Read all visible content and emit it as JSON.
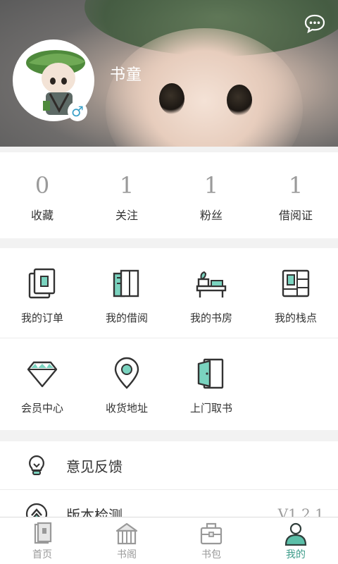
{
  "profile": {
    "username": "书童",
    "gender_symbol": "♂"
  },
  "stats": [
    {
      "count": "0",
      "label": "收藏"
    },
    {
      "count": "1",
      "label": "关注"
    },
    {
      "count": "1",
      "label": "粉丝"
    },
    {
      "count": "1",
      "label": "借阅证"
    }
  ],
  "grid": {
    "row1": [
      {
        "label": "我的订单",
        "icon": "order-icon"
      },
      {
        "label": "我的借阅",
        "icon": "borrow-icon"
      },
      {
        "label": "我的书房",
        "icon": "study-room-icon"
      },
      {
        "label": "我的栈点",
        "icon": "station-icon"
      }
    ],
    "row2": [
      {
        "label": "会员中心",
        "icon": "diamond-icon"
      },
      {
        "label": "收货地址",
        "icon": "location-pin-icon"
      },
      {
        "label": "上门取书",
        "icon": "door-icon"
      }
    ]
  },
  "list": [
    {
      "label": "意见反馈",
      "icon": "lightbulb-icon",
      "value": ""
    },
    {
      "label": "版本检测",
      "icon": "version-icon",
      "value": "V1.2.1"
    }
  ],
  "tabs": [
    {
      "label": "首页",
      "icon": "home-book-icon",
      "active": false
    },
    {
      "label": "书阁",
      "icon": "pavilion-icon",
      "active": false
    },
    {
      "label": "书包",
      "icon": "bag-icon",
      "active": false
    },
    {
      "label": "我的",
      "icon": "person-icon",
      "active": true
    }
  ],
  "colors": {
    "accent": "#3d9c8a",
    "icon_fill": "#7ad3bf",
    "icon_stroke": "#333333"
  }
}
